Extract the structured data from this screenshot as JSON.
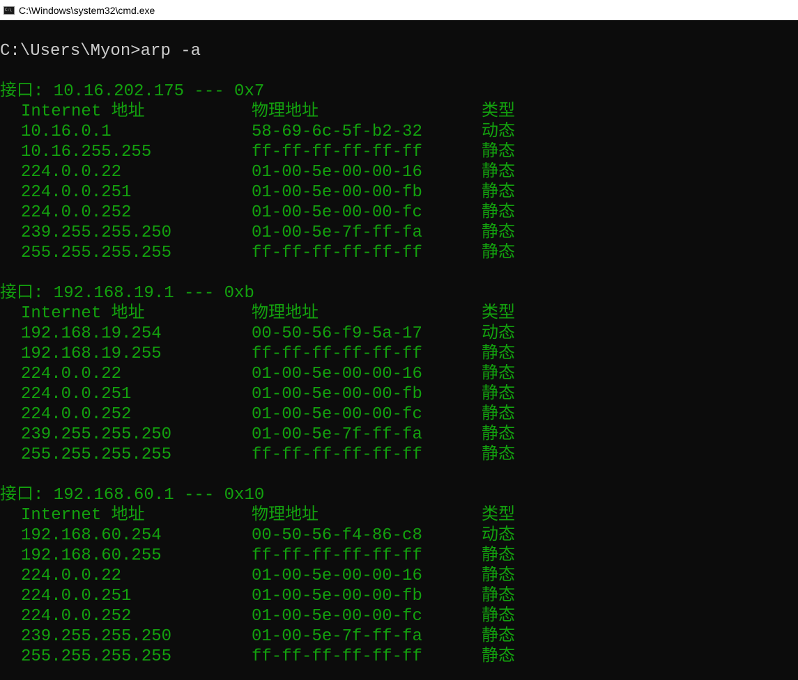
{
  "window": {
    "title": "C:\\Windows\\system32\\cmd.exe",
    "icon": "console-icon",
    "icon_glyph": "C:\\",
    "colors": {
      "background": "#0c0c0c",
      "text_output": "#13a10e",
      "text_command": "#cccccc",
      "titlebar": "#ffffff"
    }
  },
  "console": {
    "prompt_line": "C:\\Users\\Myon>arp -a",
    "interfaces": [
      {
        "header": "接口: 10.16.202.175 --- 0x7",
        "columns": [
          "Internet 地址",
          "物理地址",
          "类型"
        ],
        "rows": [
          [
            "10.16.0.1",
            "58-69-6c-5f-b2-32",
            "动态"
          ],
          [
            "10.16.255.255",
            "ff-ff-ff-ff-ff-ff",
            "静态"
          ],
          [
            "224.0.0.22",
            "01-00-5e-00-00-16",
            "静态"
          ],
          [
            "224.0.0.251",
            "01-00-5e-00-00-fb",
            "静态"
          ],
          [
            "224.0.0.252",
            "01-00-5e-00-00-fc",
            "静态"
          ],
          [
            "239.255.255.250",
            "01-00-5e-7f-ff-fa",
            "静态"
          ],
          [
            "255.255.255.255",
            "ff-ff-ff-ff-ff-ff",
            "静态"
          ]
        ]
      },
      {
        "header": "接口: 192.168.19.1 --- 0xb",
        "columns": [
          "Internet 地址",
          "物理地址",
          "类型"
        ],
        "rows": [
          [
            "192.168.19.254",
            "00-50-56-f9-5a-17",
            "动态"
          ],
          [
            "192.168.19.255",
            "ff-ff-ff-ff-ff-ff",
            "静态"
          ],
          [
            "224.0.0.22",
            "01-00-5e-00-00-16",
            "静态"
          ],
          [
            "224.0.0.251",
            "01-00-5e-00-00-fb",
            "静态"
          ],
          [
            "224.0.0.252",
            "01-00-5e-00-00-fc",
            "静态"
          ],
          [
            "239.255.255.250",
            "01-00-5e-7f-ff-fa",
            "静态"
          ],
          [
            "255.255.255.255",
            "ff-ff-ff-ff-ff-ff",
            "静态"
          ]
        ]
      },
      {
        "header": "接口: 192.168.60.1 --- 0x10",
        "columns": [
          "Internet 地址",
          "物理地址",
          "类型"
        ],
        "rows": [
          [
            "192.168.60.254",
            "00-50-56-f4-86-c8",
            "动态"
          ],
          [
            "192.168.60.255",
            "ff-ff-ff-ff-ff-ff",
            "静态"
          ],
          [
            "224.0.0.22",
            "01-00-5e-00-00-16",
            "静态"
          ],
          [
            "224.0.0.251",
            "01-00-5e-00-00-fb",
            "静态"
          ],
          [
            "224.0.0.252",
            "01-00-5e-00-00-fc",
            "静态"
          ],
          [
            "239.255.255.250",
            "01-00-5e-7f-ff-fa",
            "静态"
          ],
          [
            "255.255.255.255",
            "ff-ff-ff-ff-ff-ff",
            "静态"
          ]
        ]
      }
    ]
  }
}
